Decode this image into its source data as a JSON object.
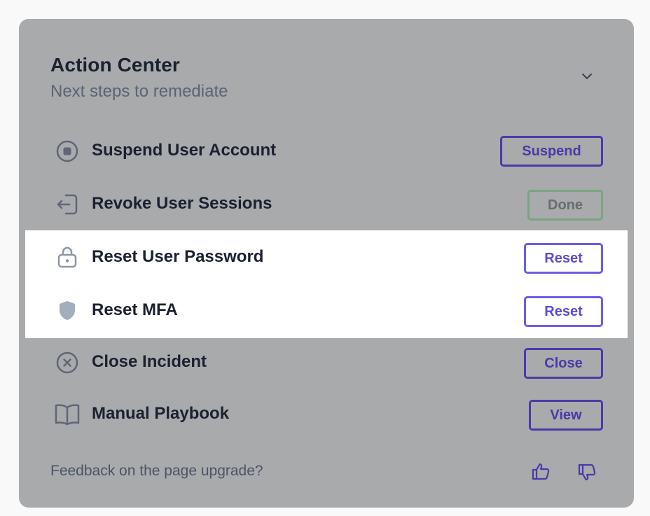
{
  "header": {
    "title": "Action Center",
    "subtitle": "Next steps to remediate"
  },
  "actions": [
    {
      "icon": "stop-circle-icon",
      "label": "Suspend User Account",
      "button": "Suspend",
      "state": "pending"
    },
    {
      "icon": "logout-icon",
      "label": "Revoke User Sessions",
      "button": "Done",
      "state": "done"
    },
    {
      "icon": "lock-icon",
      "label": "Reset User Password",
      "button": "Reset",
      "state": "pending"
    },
    {
      "icon": "shield-icon",
      "label": "Reset MFA",
      "button": "Reset",
      "state": "pending"
    },
    {
      "icon": "x-circle-icon",
      "label": "Close Incident",
      "button": "Close",
      "state": "pending"
    },
    {
      "icon": "book-icon",
      "label": "Manual Playbook",
      "button": "View",
      "state": "pending"
    }
  ],
  "footer": {
    "feedback_text": "Feedback on the page upgrade?",
    "thumbs_up_icon": "thumbs-up-icon",
    "thumbs_down_icon": "thumbs-down-icon"
  },
  "colors": {
    "card_background": "#a8aaab",
    "accent": "#4a3aa8",
    "accent_light": "#6c5ce7",
    "done_border": "#7aa382",
    "highlight": "#ffffff"
  }
}
